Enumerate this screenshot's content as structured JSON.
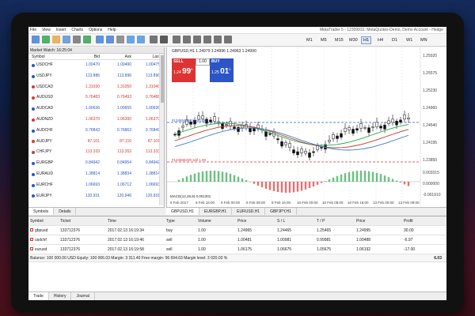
{
  "window": {
    "title": "MetaTrader 5 - 12309931: MetaQuotes-Demo, Demo Account - Hedge"
  },
  "menu": [
    "File",
    "View",
    "Insert",
    "Charts",
    "Options",
    "Help"
  ],
  "toolbar": {
    "timeframes": [
      "M1",
      "M5",
      "M15",
      "M30",
      "H1",
      "H4",
      "D1",
      "W1",
      "MN"
    ],
    "active_timeframe": "H1"
  },
  "market_watch": {
    "title": "Market Watch: 16:25:04",
    "headers": {
      "symbol": "Symbol",
      "bid": "Bid",
      "ask": "Ask",
      "last": "Last"
    },
    "rows": [
      {
        "symbol": "USDCHF",
        "bid": "1.00470",
        "ask": "1.00490",
        "last": "1.00475",
        "color": "#2b55c6"
      },
      {
        "symbol": "USDJPY",
        "bid": "113.886",
        "ask": "113.896",
        "last": "113.896",
        "color": "#2b55c6"
      },
      {
        "symbol": "USDCAD",
        "bid": "1.31030",
        "ask": "1.31050",
        "last": "1.31040",
        "color": "#d33"
      },
      {
        "symbol": "AUDUSD",
        "bid": "0.76483",
        "ask": "0.76493",
        "last": "0.76488",
        "color": "#d33"
      },
      {
        "symbol": "AUDCAD",
        "bid": "1.00636",
        "ask": "1.00655",
        "last": "1.00636",
        "color": "#2b55c6"
      },
      {
        "symbol": "AUDNZD",
        "bid": "1.06370",
        "ask": "1.06390",
        "last": "1.06370",
        "color": "#d33"
      },
      {
        "symbol": "AUDCHF",
        "bid": "0.76843",
        "ask": "0.76863",
        "last": "0.76849",
        "color": "#2b55c6"
      },
      {
        "symbol": "AUDJPY",
        "bid": "87.101",
        "ask": "87.116",
        "last": "87.101",
        "color": "#d33"
      },
      {
        "symbol": "CHFJPY",
        "bid": "113.333",
        "ask": "113.353",
        "last": "113.333",
        "color": "#d33"
      },
      {
        "symbol": "EURGBP",
        "bid": "0.84942",
        "ask": "0.84954",
        "last": "0.84942",
        "color": "#2b55c6"
      },
      {
        "symbol": "EURAUD",
        "bid": "1.38814",
        "ask": "1.38834",
        "last": "1.38814",
        "color": "#2b55c6"
      },
      {
        "symbol": "EURCHF",
        "bid": "1.06693",
        "ask": "1.06712",
        "last": "1.06693",
        "color": "#2b55c6"
      },
      {
        "symbol": "EURJPY",
        "bid": "120.931",
        "ask": "120.946",
        "last": "120.931",
        "color": "#2b55c6"
      }
    ],
    "tabs": [
      "Symbols",
      "Details"
    ]
  },
  "chart": {
    "header": "GBPUSD,H1 1.24979 1.24996 1.24963 1.24990",
    "one_click": {
      "sell_label": "SELL",
      "buy_label": "BUY",
      "lot": "1.00",
      "sell_big": "99",
      "sell_prefix": "1.24",
      "sell_sup": "9",
      "buy_big": "01",
      "buy_prefix": "1.25",
      "buy_sup": "0"
    },
    "price_labels": [
      "1.25920",
      "1.25575",
      "1.25230",
      "1.24960",
      "1.24540",
      "1.24195",
      "1.23850"
    ],
    "macd_labels": [
      "0.003315",
      "0.000000",
      "-0.001910"
    ],
    "macd_title": "MACD(12,26,9) 0.001301",
    "time_labels": [
      "8 Feb 2017",
      "8 Feb 16:00",
      "9 Feb 00:00",
      "9 Feb 08:00",
      "9 Feb 16:00",
      "10 Feb 00:00",
      "10 Feb 08:00",
      "10 Feb 16:00",
      "13 Feb 00:00",
      "13 Feb 08:00"
    ],
    "line_labels": [
      "#134554356 buy 1.00",
      "#134555230 sell 1.00"
    ],
    "tabs": [
      "GBPUSD,H1",
      "EURGBP,H1",
      "EURUSD,H1",
      "GBPJPY,H1"
    ]
  },
  "trade": {
    "headers": [
      "Symbol",
      "Ticket",
      "Time",
      "Type",
      "Volume",
      "Price",
      "S / L",
      "T / P",
      "Price",
      "Profit"
    ],
    "rows": [
      [
        "gbpusd",
        "133712376",
        "2017.02.13 16:19:34",
        "buy",
        "1.00",
        "1.24965",
        "1.24465",
        "1.25465",
        "1.24995",
        "30.00"
      ],
      [
        "usdchf",
        "133712376",
        "2017.02.13 16:19:46",
        "sell",
        "1.00",
        "1.00481",
        "1.00981",
        "0.99981",
        "1.00488",
        "-6.97"
      ],
      [
        "eurusd",
        "133712376",
        "2017.02.13 16:19:58",
        "sell",
        "1.00",
        "1.06175",
        "1.06675",
        "1.05675",
        "1.06192",
        "-17.00"
      ]
    ],
    "balance": "Balance: 100 000.00 USD   Equity: 100 006.03   Margin: 3 311.40   Free margin: 96 694.63   Margin level: 3 020.03 %",
    "total": "6.03",
    "tabs": [
      "Trade",
      "History",
      "Journal"
    ]
  }
}
